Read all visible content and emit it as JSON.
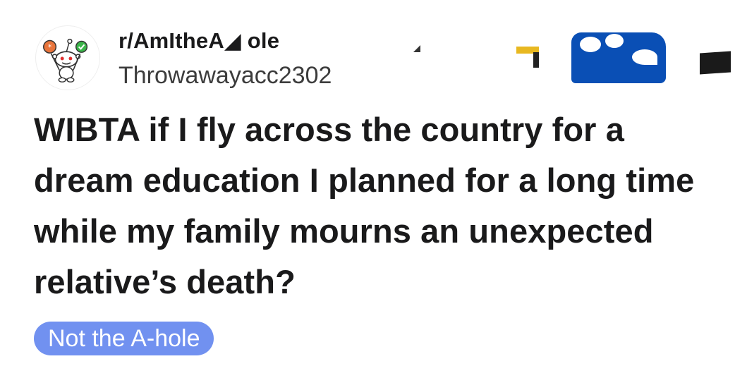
{
  "post": {
    "subreddit": "r/AmItheA◢ ole",
    "username": "Throwawayacc2302",
    "title": "WIBTA if I fly across the country for a dream education I planned for a long time while my family mourns an unexpected relative’s death?",
    "flair": "Not the A-hole"
  },
  "icons": {
    "avatar": "reddit-snoo-icon"
  },
  "colors": {
    "flair_bg": "#7191f0",
    "flair_text": "#ffffff",
    "text_primary": "#1a1a1b",
    "text_secondary": "#3c3c3c",
    "redaction_blue": "#0a4fb5",
    "redaction_gold": "#e8b820",
    "redaction_dark": "#1a1a1a"
  }
}
